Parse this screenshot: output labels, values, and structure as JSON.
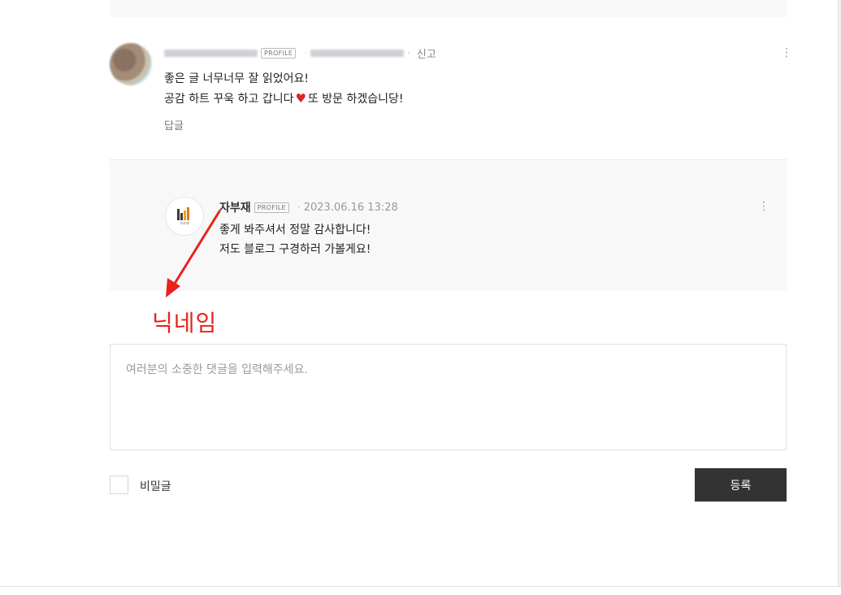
{
  "comment": {
    "report_label": "신고",
    "profile_badge": "PROFILE",
    "text_line1": "좋은 글 너무너무 잘 읽었어요!",
    "text_line2a": "공감 하트 꾸욱 하고 갑니다",
    "heart_glyph": "♥",
    "text_line2b": "또 방문 하겠습니당!",
    "reply_label": "답글",
    "more_glyph": "⋮"
  },
  "reply": {
    "author": "자부재",
    "profile_badge": "PROFILE",
    "separator": "·",
    "date": "2023.06.16 13:28",
    "text_line1": "좋게 봐주셔서 정말 감사합니다!",
    "text_line2": "저도 블로그 구경하러 가볼게요!",
    "more_glyph": "⋮",
    "logo_text": "자부재"
  },
  "annotation": {
    "label": "닉네임",
    "color": "#e8221b"
  },
  "form": {
    "placeholder": "여러분의 소중한 댓글을 입력해주세요.",
    "secret_label": "비밀글",
    "submit_label": "등록"
  },
  "icons": {
    "more": "more-vertical-icon",
    "heart": "heart-icon",
    "checkbox": "checkbox-icon"
  }
}
